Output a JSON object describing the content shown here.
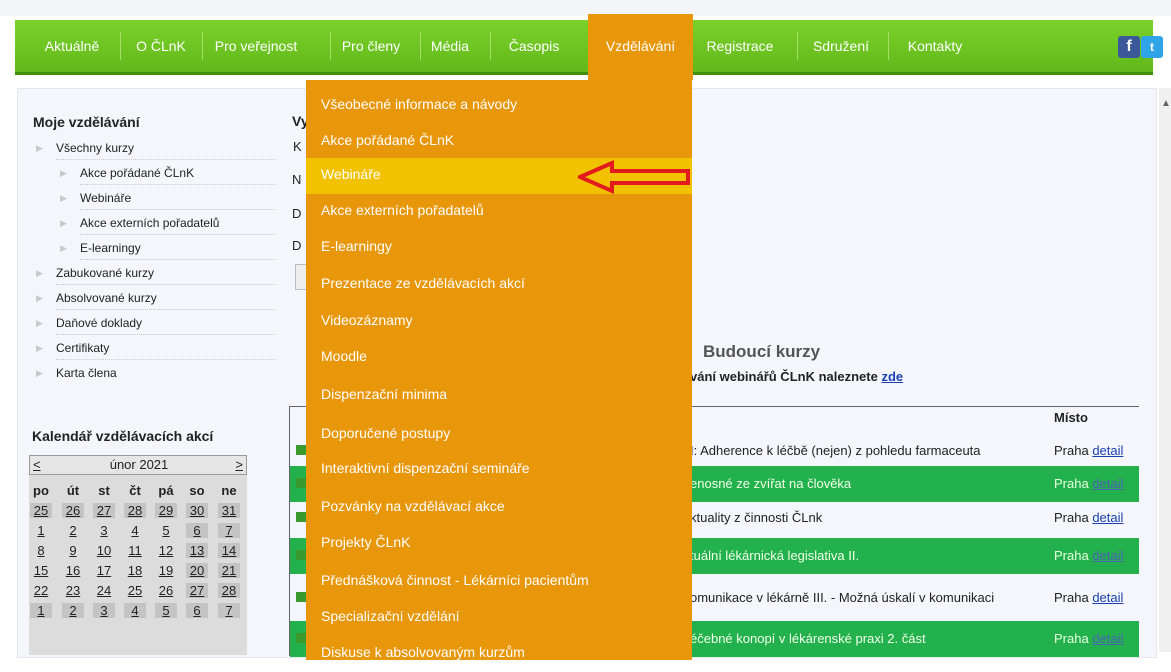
{
  "nav": {
    "items": [
      "Aktuálně",
      "O ČLnK",
      "Pro veřejnost",
      "Pro členy",
      "Média",
      "Časopis",
      "Vzdělávání",
      "Registrace",
      "Sdružení",
      "Kontakty"
    ],
    "active": "Vzdělávání",
    "social": {
      "facebook": "f",
      "twitter": "t"
    }
  },
  "sidebar": {
    "title": "Moje vzdělávání",
    "items": [
      "Všechny kurzy",
      "Akce pořádané ČLnK",
      "Webináře",
      "Akce externích pořadatelů",
      "E-learningy",
      "Zabukované kurzy",
      "Absolvované kurzy",
      "Daňové doklady",
      "Certifikaty",
      "Karta člena"
    ]
  },
  "calendar": {
    "title": "Kalendář vzdělávacích akcí",
    "prev": "<",
    "next": ">",
    "month": "únor 2021",
    "weekdays": [
      "po",
      "út",
      "st",
      "čt",
      "pá",
      "so",
      "ne"
    ],
    "weeks": [
      [
        "25",
        "26",
        "27",
        "28",
        "29",
        "30",
        "31"
      ],
      [
        "1",
        "2",
        "3",
        "4",
        "5",
        "6",
        "7"
      ],
      [
        "8",
        "9",
        "10",
        "11",
        "12",
        "13",
        "14"
      ],
      [
        "15",
        "16",
        "17",
        "18",
        "19",
        "20",
        "21"
      ],
      [
        "22",
        "23",
        "24",
        "25",
        "26",
        "27",
        "28"
      ],
      [
        "1",
        "2",
        "3",
        "4",
        "5",
        "6",
        "7"
      ]
    ]
  },
  "main": {
    "fragments": [
      "Vy",
      "K",
      "N",
      "D",
      "D"
    ]
  },
  "future": {
    "title": "Budoucí kurzy",
    "sub_text": "vání webinářů ČLnK naleznete",
    "sub_link": "zde",
    "place_header": "Místo",
    "rows": [
      {
        "course": "I: Adherence k léčbě (nejen) z pohledu farmaceuta",
        "city": "Praha",
        "detail": "detail",
        "green": false
      },
      {
        "course": "enosné ze zvířat na člověka",
        "city": "Praha",
        "detail": "detail",
        "green": true
      },
      {
        "course": "ktuality z činnosti ČLnk",
        "city": "Praha",
        "detail": "detail",
        "green": false
      },
      {
        "course": "tuální lékárnická legislativa II.",
        "city": "Praha",
        "detail": "detail",
        "green": true
      },
      {
        "course": "omunikace v lékárně III. - Možná úskalí v komunikaci",
        "city": "Praha",
        "detail": "detail",
        "green": false
      },
      {
        "course": "éčebné konopí v lékárenské praxi 2. část",
        "city": "Praha",
        "detail": "detail",
        "green": true
      }
    ]
  },
  "dropdown": {
    "items": [
      "Všeobecné informace a návody",
      "Akce pořádané ČLnK",
      "Webináře",
      "Akce externích pořadatelů",
      "E-learningy",
      "Prezentace ze vzdělávacích akcí",
      "Videozáznamy",
      "Moodle",
      "Dispenzační minima",
      "Doporučené postupy",
      "Interaktivní dispenzační semináře",
      "Pozvánky na vzdělávací akce",
      "Projekty ČLnK",
      "Přednášková činnost - Lékárníci pacientům",
      "Specializační vzdělání",
      "Diskuse k absolvovaným kurzům"
    ],
    "highlighted": "Webináře"
  },
  "colors": {
    "nav_green": "#6cc61f",
    "dropdown_orange": "#e8960a",
    "highlight_yellow": "#f2c200",
    "row_green": "#22b14c",
    "arrow_red": "#e21c1c"
  }
}
